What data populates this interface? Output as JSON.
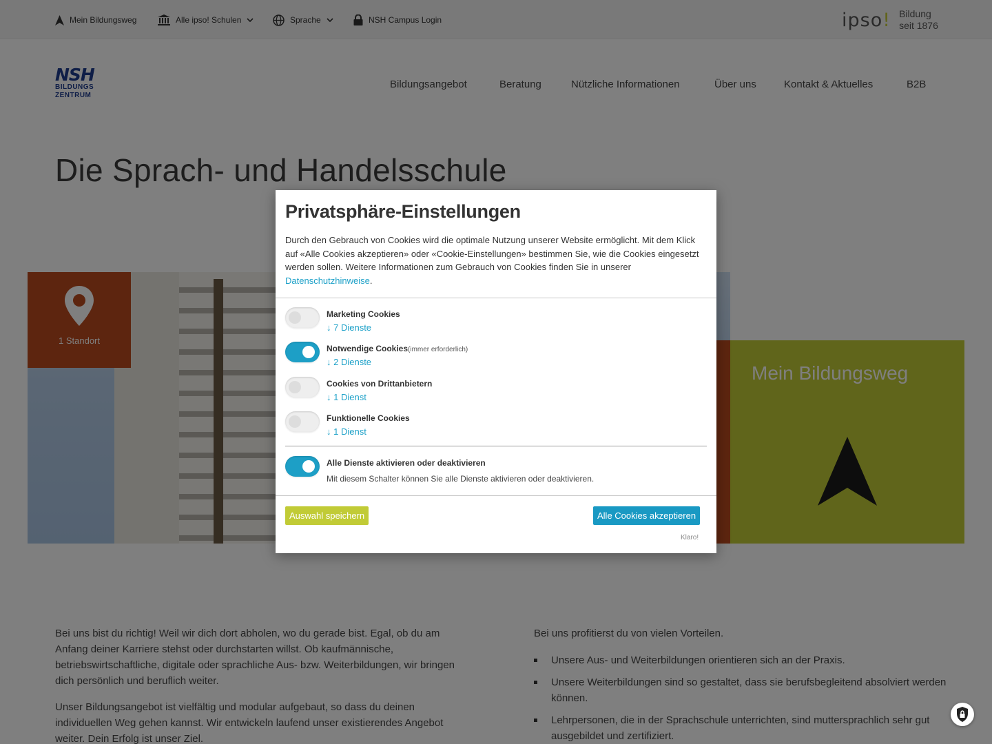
{
  "topbar": {
    "my_path": "Mein Bildungsweg",
    "schools": "Alle ipso! Schulen",
    "language": "Sprache",
    "campus_login": "NSH Campus Login",
    "ipso_word": "ipso",
    "ipso_bang": "!",
    "ipso_sub1": "Bildung",
    "ipso_sub2": "seit 1876"
  },
  "logo": {
    "line1": "NSH",
    "line2": "BILDUNGS",
    "line3": "ZENTRUM"
  },
  "nav": {
    "items": [
      "Bildungsangebot",
      "Beratung",
      "Nützliche Informationen",
      "Über uns",
      "Kontakt & Aktuelles",
      "B2B"
    ]
  },
  "page": {
    "title": "Die Sprach- und Handelsschule"
  },
  "hero": {
    "location_label": "1 Standort",
    "tile_title": "Mein Bildungsweg",
    "accent_orange": "#bb4a1e",
    "accent_green": "#c1cb36"
  },
  "content": {
    "left_p1": "Bei uns bist du richtig! Weil wir dich dort abholen, wo du gerade bist. Egal, ob du am Anfang deiner Karriere stehst oder durchstarten willst. Ob kaufmännische, betriebswirtschaftliche, digitale oder sprachliche Aus- bzw. Weiterbildungen, wir bringen dich persönlich und beruflich weiter.",
    "left_p2": "Unser Bildungsangebot ist vielfältig und modular aufgebaut, so dass du deinen individuellen Weg gehen kannst. Wir entwickeln laufend unser existierendes Angebot weiter. Dein Erfolg ist unser Ziel.",
    "right_intro": "Bei uns profitierst du von vielen Vorteilen.",
    "right_list": [
      "Unsere Aus- und Weiterbildungen orientieren sich an der Praxis.",
      "Unsere Weiterbildungen sind so gestaltet, dass sie berufsbegleitend absolviert werden können.",
      "Lehrpersonen, die in der Sprachschule unterrichten, sind muttersprachlich sehr gut ausgebildet und zertifiziert."
    ]
  },
  "modal": {
    "title": "Privatsphäre-Einstellungen",
    "intro": "Durch den Gebrauch von Cookies wird die optimale Nutzung unserer Website ermöglicht. Mit dem Klick auf «Alle Cookies akzeptieren» oder «Cookie-Einstellungen» bestimmen Sie, wie die Cookies eingesetzt werden sollen. Weitere Informationen zum Gebrauch von Cookies finden Sie in unserer ",
    "intro_link": "Datenschutzhinweise",
    "intro_end": ".",
    "services": [
      {
        "name": "Marketing Cookies",
        "required": "",
        "count": "↓ 7 Dienste",
        "enabled": false
      },
      {
        "name": "Notwendige Cookies",
        "required": "(immer erforderlich)",
        "count": "↓ 2 Dienste",
        "enabled": true
      },
      {
        "name": "Cookies von Drittanbietern",
        "required": "",
        "count": "↓ 1 Dienst",
        "enabled": false
      },
      {
        "name": "Funktionelle Cookies",
        "required": "",
        "count": "↓ 1 Dienst",
        "enabled": false
      }
    ],
    "toggle_all": {
      "name": "Alle Dienste aktivieren oder deaktivieren",
      "desc": "Mit diesem Schalter können Sie alle Dienste aktivieren oder deaktivieren.",
      "enabled": true
    },
    "save_label": "Auswahl speichern",
    "accept_label": "Alle Cookies akzeptieren",
    "klaro": "Klaro!"
  }
}
